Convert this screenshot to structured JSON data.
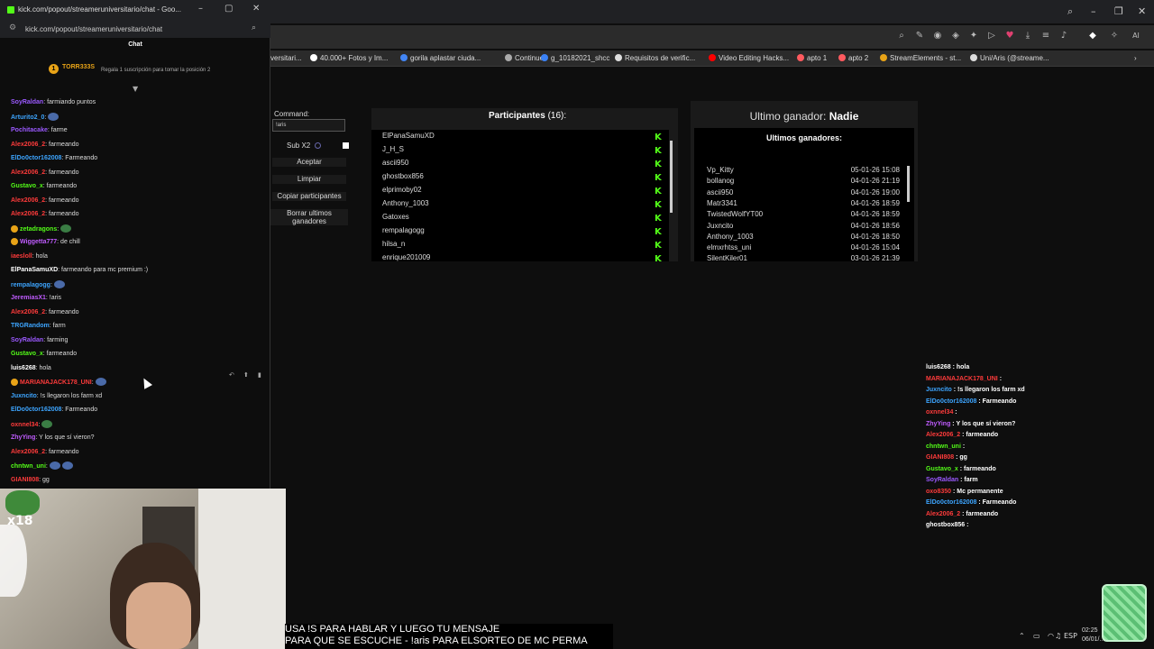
{
  "popup": {
    "title": "kick.com/popout/streameruniversitario/chat - Goo...",
    "url": "kick.com/popout/streameruniversitario/chat",
    "chat_header": "Chat",
    "pinned_name": "TORR333S",
    "pinned_text": "Regala 1 suscripción para tomar la posición 2",
    "messages": [
      {
        "name": "SoyRaldan",
        "color": "#9b59ff",
        "text": ": farmiando puntos",
        "emote": ""
      },
      {
        "name": "Arturito2_0",
        "color": "#3da5ff",
        "text": ":",
        "emote": "blue"
      },
      {
        "name": "Pochitacake",
        "color": "#9b59ff",
        "text": ": farme",
        "emote": ""
      },
      {
        "name": "Alex2006_2",
        "color": "#ff3b3b",
        "text": ": farmeando",
        "emote": ""
      },
      {
        "name": "ElDo0ctor162008",
        "color": "#3da5ff",
        "text": ": Farmeando",
        "emote": ""
      },
      {
        "name": "Alex2006_2",
        "color": "#ff3b3b",
        "text": ": farmeando",
        "emote": ""
      },
      {
        "name": "Gustavo_x",
        "color": "#53fc18",
        "text": ": farmeando",
        "emote": ""
      },
      {
        "name": "Alex2006_2",
        "color": "#ff3b3b",
        "text": ": farmeando",
        "emote": ""
      },
      {
        "name": "Alex2006_2",
        "color": "#ff3b3b",
        "text": ": farmeando",
        "emote": ""
      },
      {
        "name": "zetadragons",
        "color": "#53fc18",
        "text": ":",
        "emote": "green"
      },
      {
        "name": "Wiggetta777",
        "color": "#c05cff",
        "text": ": de chill",
        "emote": ""
      },
      {
        "name": "iaesloll",
        "color": "#ff3b3b",
        "text": ": hola",
        "emote": ""
      },
      {
        "name": "ElPanaSamuXD",
        "color": "#ffffff",
        "text": ": farmeando para mc premium :)",
        "emote": ""
      },
      {
        "name": "rempalagogg",
        "color": "#3da5ff",
        "text": ":",
        "emote": "blue"
      },
      {
        "name": "JeremiasX1",
        "color": "#c05cff",
        "text": ": !aris",
        "emote": ""
      },
      {
        "name": "Alex2006_2",
        "color": "#ff3b3b",
        "text": ": farmeando",
        "emote": ""
      },
      {
        "name": "TRGRandom",
        "color": "#3da5ff",
        "text": ": farm",
        "emote": ""
      },
      {
        "name": "SoyRaldan",
        "color": "#9b59ff",
        "text": ": farming",
        "emote": ""
      },
      {
        "name": "Gustavo_x",
        "color": "#53fc18",
        "text": ": farmeando",
        "emote": ""
      },
      {
        "name": "luis6268",
        "color": "#ffffff",
        "text": ": hola",
        "emote": ""
      },
      {
        "name": "MARIANAJACK178_UNI",
        "color": "#ff3b3b",
        "text": ":",
        "emote": "blue"
      },
      {
        "name": "Juxncito",
        "color": "#3da5ff",
        "text": ": !s llegaron los farm xd",
        "emote": ""
      },
      {
        "name": "ElDo0ctor162008",
        "color": "#3da5ff",
        "text": ": Farmeando",
        "emote": ""
      },
      {
        "name": "oxnnel34",
        "color": "#ff3b3b",
        "text": ":",
        "emote": "green"
      },
      {
        "name": "ZhyYing",
        "color": "#c05cff",
        "text": ": Y los que sí vieron?",
        "emote": ""
      },
      {
        "name": "Alex2006_2",
        "color": "#ff3b3b",
        "text": ": farmeando",
        "emote": ""
      },
      {
        "name": "chntwn_uni",
        "color": "#53fc18",
        "text": ":",
        "emote": "blue2"
      },
      {
        "name": "GIANI808",
        "color": "#ff3b3b",
        "text": ": gg",
        "emote": ""
      }
    ]
  },
  "bookmarks": [
    "versitari...",
    "40.000+ Fotos y Im...",
    "gorila aplastar ciuda...",
    "Continue",
    "g_10182021_shcc",
    "Requisitos de verific...",
    "Video Editing Hacks...",
    "apto 1",
    "apto 2",
    "StreamElements - st...",
    "Uni/Aris (@streame..."
  ],
  "raffle": {
    "command_label": "Command:",
    "command_value": "!aris",
    "sub_label": "Sub X2",
    "buttons": [
      "Aceptar",
      "Limpiar",
      "Copiar participantes",
      "Borrar ultimos ganadores"
    ],
    "participants_label": "Participantes",
    "participants_count": "(16):",
    "participants": [
      "ElPanaSamuXD",
      "J_H_S",
      "ascii950",
      "ghostbox856",
      "elprimoby02",
      "Anthony_1003",
      "Gatoxes",
      "rempalagogg",
      "hilsa_n",
      "enrique201009"
    ],
    "last_winner_label": "Ultimo ganador:",
    "last_winner_value": "Nadie",
    "winners_title": "Ultimos ganadores:",
    "winners": [
      {
        "name": "Vp_Kitty",
        "date": "05-01-26 15:08"
      },
      {
        "name": "bollanog",
        "date": "04-01-26 21:19"
      },
      {
        "name": "ascii950",
        "date": "04-01-26 19:00"
      },
      {
        "name": "Matr3341",
        "date": "04-01-26 18:59"
      },
      {
        "name": "TwistedWolfYT00",
        "date": "04-01-26 18:59"
      },
      {
        "name": "Juxncito",
        "date": "04-01-26 18:56"
      },
      {
        "name": "Anthony_1003",
        "date": "04-01-26 18:50"
      },
      {
        "name": "elmxrhtss_uni",
        "date": "04-01-26 15:04"
      },
      {
        "name": "SilentKiler01",
        "date": "03-01-26 21:39"
      }
    ]
  },
  "overlay_chat": [
    {
      "name": "luis6268",
      "color": "#ffffff",
      "text": " : hola"
    },
    {
      "name": "MARIANAJACK178_UNI",
      "color": "#ff3b3b",
      "text": " :"
    },
    {
      "name": "Juxncito",
      "color": "#3da5ff",
      "text": " : !s llegaron los farm xd"
    },
    {
      "name": "ElDo0ctor162008",
      "color": "#3da5ff",
      "text": " : Farmeando"
    },
    {
      "name": "oxnnel34",
      "color": "#ff3b3b",
      "text": " :"
    },
    {
      "name": "ZhyYing",
      "color": "#c05cff",
      "text": " : Y los que sí vieron?"
    },
    {
      "name": "Alex2006_2",
      "color": "#ff3b3b",
      "text": " : farmeando"
    },
    {
      "name": "chntwn_uni",
      "color": "#53fc18",
      "text": " :"
    },
    {
      "name": "GIANI808",
      "color": "#ff3b3b",
      "text": " : gg"
    },
    {
      "name": "Gustavo_x",
      "color": "#53fc18",
      "text": " : farmeando"
    },
    {
      "name": "SoyRaldan",
      "color": "#9b59ff",
      "text": " : farm"
    },
    {
      "name": "oxo8350",
      "color": "#ff3b3b",
      "text": " : Mc permanente"
    },
    {
      "name": "ElDo0ctor162008",
      "color": "#3da5ff",
      "text": " : Farmeando"
    },
    {
      "name": "Alex2006_2",
      "color": "#ff3b3b",
      "text": " : farmeando"
    },
    {
      "name": "ghostbox856",
      "color": "#ffffff",
      "text": " :"
    }
  ],
  "subtitle": {
    "line1": "USA !S PARA HABLAR Y LUEGO TU MENSAJE",
    "line2": "PARA QUE SE ESCUCHE - !aris PARA ELSORTEO DE MC PERMA"
  },
  "taskbar": {
    "lang": "ESP",
    "time": "02:25",
    "date": "06/01/..."
  },
  "webcam": {
    "overlay_text": "x18"
  }
}
